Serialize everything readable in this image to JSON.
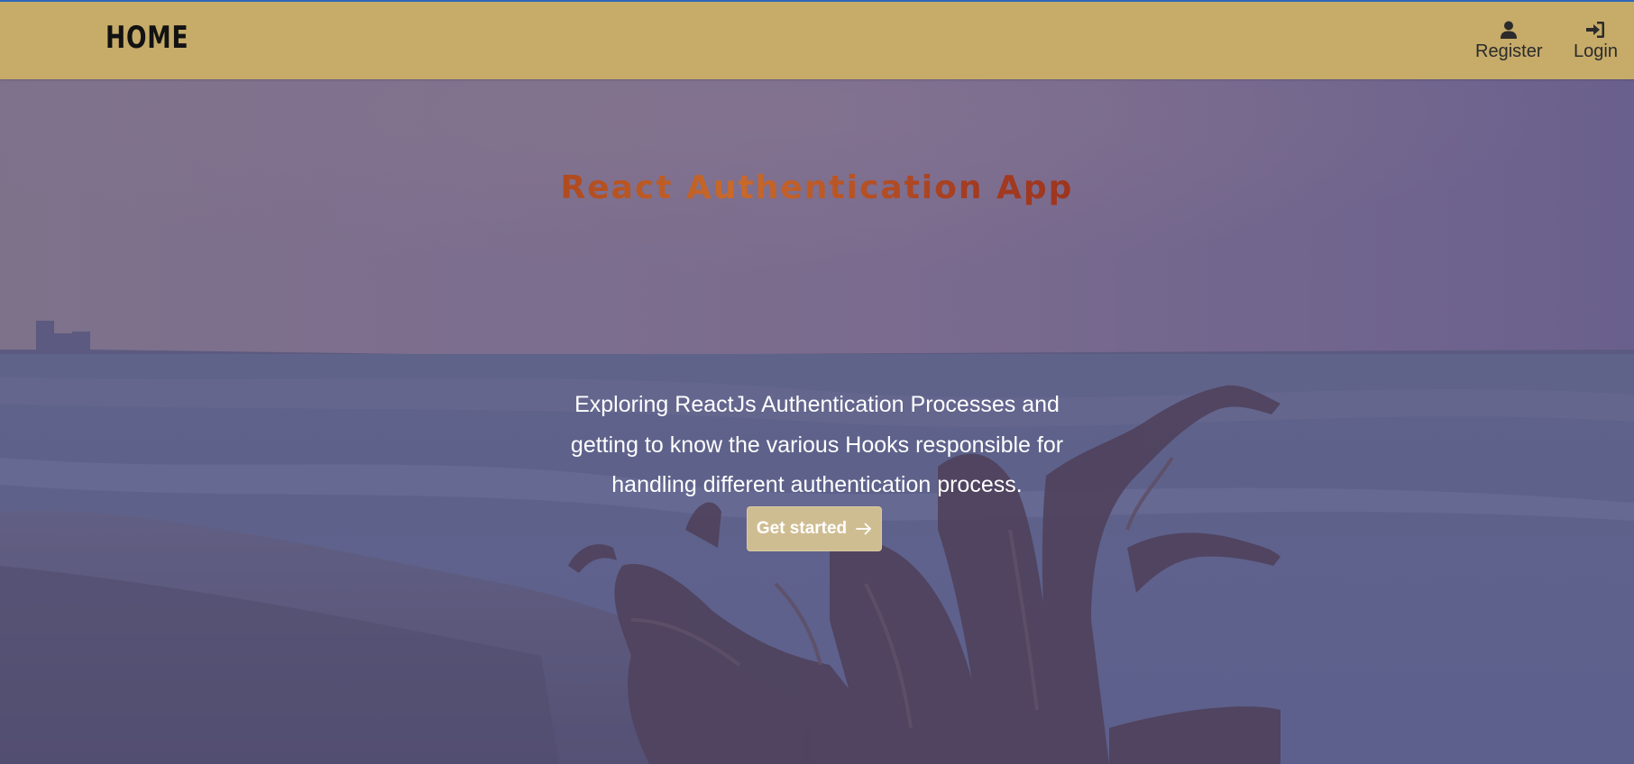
{
  "header": {
    "brand": "HOME",
    "nav": [
      {
        "label": "Register",
        "icon": "user-icon"
      },
      {
        "label": "Login",
        "icon": "sign-in-icon"
      }
    ]
  },
  "hero": {
    "title": "React Authentication App",
    "description": "Exploring ReactJs Authentication Processes and getting to know the various Hooks responsible for handling different authentication process.",
    "cta_label": "Get started",
    "cta_icon": "arrow-right-icon"
  },
  "colors": {
    "navbar": "#c6ab69",
    "top_border": "#2f67b8",
    "title_gradient": [
      "#8a2a1c",
      "#c96a2a",
      "#7c1e1a"
    ],
    "cta_background": "#cfbd92",
    "overlay": "#6f6a9a"
  }
}
